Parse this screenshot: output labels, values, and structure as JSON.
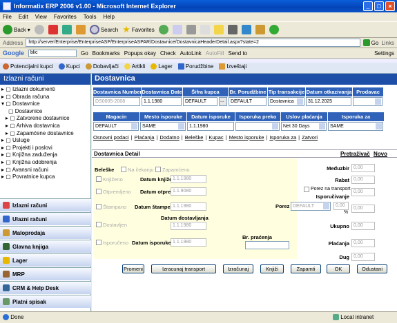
{
  "window": {
    "title": "Informatix ERP 2006 v1.00 - Microsoft Internet Explorer"
  },
  "menu": [
    "File",
    "Edit",
    "View",
    "Favorites",
    "Tools",
    "Help"
  ],
  "toolbar": {
    "back": "Back",
    "search": "Search",
    "favorites": "Favorites"
  },
  "address": {
    "label": "Address",
    "url": "http://server/Enterprise/EnterpriseASP/EnterpriseASPAR/Dostavnice/DostavnicaHeaderDetail.aspx?state=2",
    "go": "Go",
    "links": "Links"
  },
  "google": {
    "label": "Google",
    "query": "blic",
    "go": "Go",
    "bookmarks": "Bookmarks",
    "popups": "Popups okay",
    "check": "Check",
    "autolink": "AutoLink",
    "autofill": "AutoFill",
    "sendto": "Send to",
    "settings": "Settings"
  },
  "app_toolbar": {
    "items": [
      "Potencijalni kupci",
      "Kupci",
      "Dobavljači",
      "Artikli",
      "Lager",
      "Porudžbine",
      "Izveštaji"
    ]
  },
  "sidebar": {
    "title": "Izlazni računi",
    "tree": [
      "Izlazni dokumenti",
      "Obrada računa",
      "Dostavnice",
      "Dostavnice",
      "Zatvorene dostavnice",
      "Arhiva dostavnica",
      "Zapamćene dostavnice",
      "Usluge",
      "Projekti i poslovi",
      "Knjižna zaduženja",
      "Knjižna odobrenja",
      "Avansni računi",
      "Povratnice kupca"
    ],
    "nav": [
      "Izlazni računi",
      "Ulazni računi",
      "Maloprodaja",
      "Glavna knjiga",
      "Lager",
      "MRP",
      "CRM & Help Desk",
      "Platni spisak"
    ]
  },
  "content": {
    "title": "Dostavnica",
    "row1_headers": [
      "Dostavnica Number",
      "Dostavnica Date",
      "Šifra kupca",
      "Br. Porudžbine",
      "Tip transakcije",
      "Datum otkazivanja",
      "Prodavac"
    ],
    "row1_values": {
      "number": "DS0005-2008",
      "date": "1.1.1980",
      "kupac": "DEFAULT",
      "kupac_btn": "...",
      "porudzbina": "DEFAULT",
      "tip": "Dostavnica",
      "otkazivanje": "31.12.2025",
      "prodavac": ""
    },
    "row2_headers": [
      "Magacin",
      "Mesto isporuke",
      "Datum isporuke",
      "Isporuka preko",
      "Uslov plaćanja",
      "Isporuka za"
    ],
    "row2_values": {
      "magacin": "DEFAULT",
      "mesto": "SAME",
      "datum": "1.1.1980",
      "preko": "",
      "uslov": "Net 30 Days",
      "za": "SAME"
    },
    "tabs": [
      "Osnovni podaci",
      "Plaćanja",
      "Dodatno",
      "Beleške",
      "Kupac",
      "Mesto isporuke",
      "Isporuka za",
      "Zatvori"
    ],
    "detail_title": "Dostavnica Detail",
    "detail_links": [
      "Pretraživač",
      "Novo"
    ],
    "left": {
      "beleske": "Beleške",
      "na_cekanju": "Na čekanju",
      "zapamceno": "Zapamćeno",
      "knjizeno": "Knjiženo",
      "datum_knjizenja": "Datum knjiženja",
      "datum_knjizenja_val": "1.1.1980",
      "otpremljeno": "Otpremljeno",
      "datum_otpreme": "Datum otpreme",
      "datum_otpreme_val": "1.1.9080",
      "stampano": "Štampano",
      "datum_stampe": "Datum štampe",
      "datum_stampe_val": "1.1.1980",
      "dostavljen": "Dostavljen",
      "datum_dostavljanja": "Datum dostavljanja",
      "datum_dostavljanja_val": "1.1.1980",
      "isporuceno": "Isporučeno",
      "datum_isporuke": "Datum isporuke",
      "datum_isporuke_val": "1.1.1980",
      "br_pracenja": "Br. praćenja"
    },
    "right": {
      "medjuzbir": "Međuzbir",
      "medjuzbir_val": "0,00",
      "rabat": "Rabat",
      "rabat_val": "0,00",
      "porez_transport": "Porez na transport",
      "isporucivanje": "Isporučivanje",
      "isporucivanje_val": "0,00",
      "porez": "Porez",
      "porez_sel": "DEFAULT",
      "porez_pct": "0,00",
      "pct": "%",
      "porez_val": "0,00",
      "ukupno": "Ukupno",
      "ukupno_val": "0,00",
      "placanja": "Plaćanja",
      "placanja_val": "0,00",
      "dug": "Dug",
      "dug_val": "0,00"
    },
    "buttons": [
      "Promeni",
      "Izracunaj transport",
      "Izračunaj",
      "Knjiži",
      "Zapamti",
      "OK",
      "Odustani"
    ]
  },
  "status": {
    "left": "Done",
    "right": "Local intranet"
  }
}
